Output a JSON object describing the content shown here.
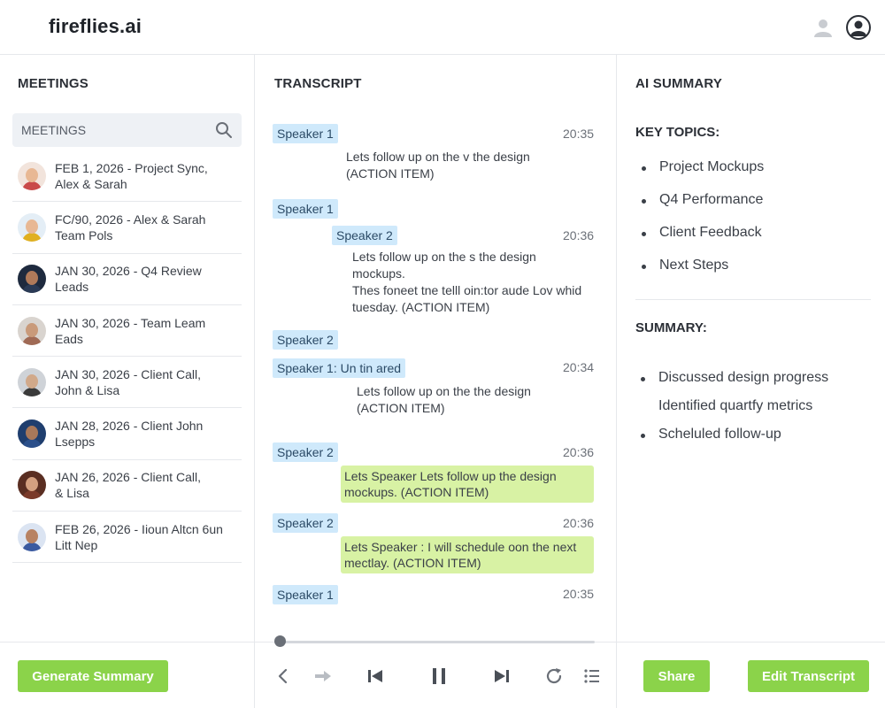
{
  "app": {
    "logo": "fireflies.ai"
  },
  "header": {
    "user_icon": "user-icon",
    "avatar_icon": "account-avatar-icon"
  },
  "meetings": {
    "title": "MEETINGS",
    "search_placeholder": "MEETINGS",
    "items": [
      {
        "line1": "FEB 1, 2026 - Project Sync,",
        "line2": "Alex & Sarah",
        "avatar_color": "#c94a4a"
      },
      {
        "line1": "FC/90, 2026 - Alex & Sarah",
        "line2": "Team Pols",
        "avatar_color": "#e0b020"
      },
      {
        "line1": "JAN 30, 2026 - Q4 Review",
        "line2": "Leads",
        "avatar_color": "#2a3a55"
      },
      {
        "line1": "JAN 30, 2026 - Team Leam",
        "line2": "Eads",
        "avatar_color": "#a06a55"
      },
      {
        "line1": "JAN 30, 2026 - Client Call,",
        "line2": "John & Lisa",
        "avatar_color": "#3a3a3a"
      },
      {
        "line1": "JAN 28, 2026 - Client John",
        "line2": "Lsepps",
        "avatar_color": "#2b4f8a"
      },
      {
        "line1": "JAN 26, 2026 - Client Call,",
        "line2": "& Lisa",
        "avatar_color": "#7a3a2a"
      },
      {
        "line1": "FEB 26, 2026 - Iioun Altcn 6un",
        "line2": "Litt Nep",
        "avatar_color": "#3a5aa0"
      }
    ],
    "generate_button": "Generate Summary"
  },
  "transcript": {
    "title": "TRANSCRIPT",
    "entries": [
      {
        "speaker": "Speaker 1",
        "time": "20:35",
        "line1": "Lets follow up on the v the design",
        "line2": "(ACTION ITEM)"
      },
      {
        "speaker": "Speaker 1"
      },
      {
        "speaker": "Speaker 2",
        "time": "20:36",
        "line1": "Lets follow up on the s the design",
        "line2": "mockups.",
        "line3": "Thes foneet tne telll oin:tor aude Lov whid",
        "line4": "tuesday. (ACTION ITEM)"
      },
      {
        "speaker": "Speaker 2"
      },
      {
        "speaker": "Speaker 1: Un tin ared",
        "time": "20:34",
        "line1": "Lets follow up on the the design",
        "line2": "(ACTION ITEM)"
      },
      {
        "speaker": "Speaker 2",
        "time": "20:36",
        "hl1": "Lets Sреакer Lets follow up the design",
        "hl2": "mockups. (ACTION ITEM)"
      },
      {
        "speaker": "Speaker 2",
        "time": "20:36",
        "hl1": "Lets Speaker : I will schedule oon the next",
        "hl2": "mectlay. (ACTION ITEM)"
      },
      {
        "speaker": "Speaker 1",
        "time": "20:35"
      }
    ],
    "playback_progress": 0.0,
    "controls": [
      "back-icon",
      "forward-icon",
      "skip-previous-icon",
      "pause-icon",
      "skip-next-icon",
      "replay-icon",
      "list-icon"
    ]
  },
  "summary": {
    "title": "AI SUMMARY",
    "key_topics_title": "KEY TOPICS:",
    "key_topics": [
      "Project Mockups",
      "Q4 Performance",
      "Client Feedback",
      "Next Steps"
    ],
    "summary_title": "SUMMARY:",
    "summary_items": [
      {
        "text": "Discussed design progress",
        "bullet": true
      },
      {
        "text": "Identified quartfy metrics",
        "bullet": false
      },
      {
        "text": "Scheluled follow-up",
        "bullet": true
      }
    ],
    "share_button": "Share",
    "edit_button": "Edit Transcript"
  }
}
